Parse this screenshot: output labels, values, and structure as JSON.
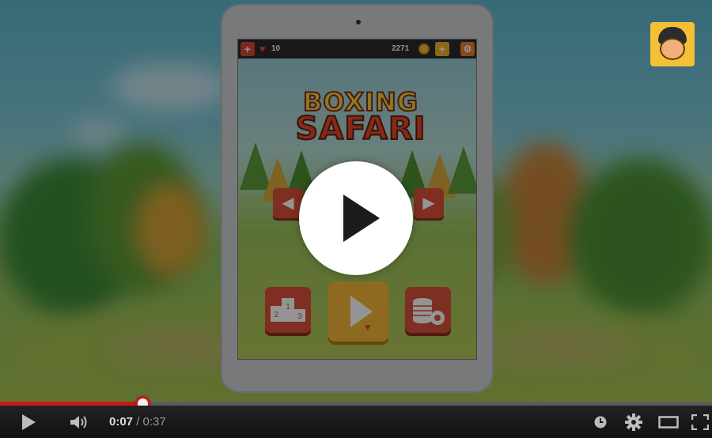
{
  "video": {
    "current_time": "0:07",
    "separator": "/",
    "duration": "0:37",
    "progress_fraction": 0.2
  },
  "game": {
    "logo_line1": "BOXING",
    "logo_line2": "SAFARI",
    "lives": "10",
    "coins": "2271",
    "podium_labels": [
      "1",
      "2",
      "3"
    ]
  },
  "colors": {
    "progress_played": "#cc181e",
    "game_button": "#d9513a",
    "play_button": "#f4b73a"
  },
  "icons": {
    "big_play": "play-icon",
    "control_play": "play-icon",
    "volume": "volume-icon",
    "watch_later": "clock-icon",
    "settings": "gear-icon",
    "theater": "theater-mode-icon",
    "fullscreen": "fullscreen-icon"
  }
}
